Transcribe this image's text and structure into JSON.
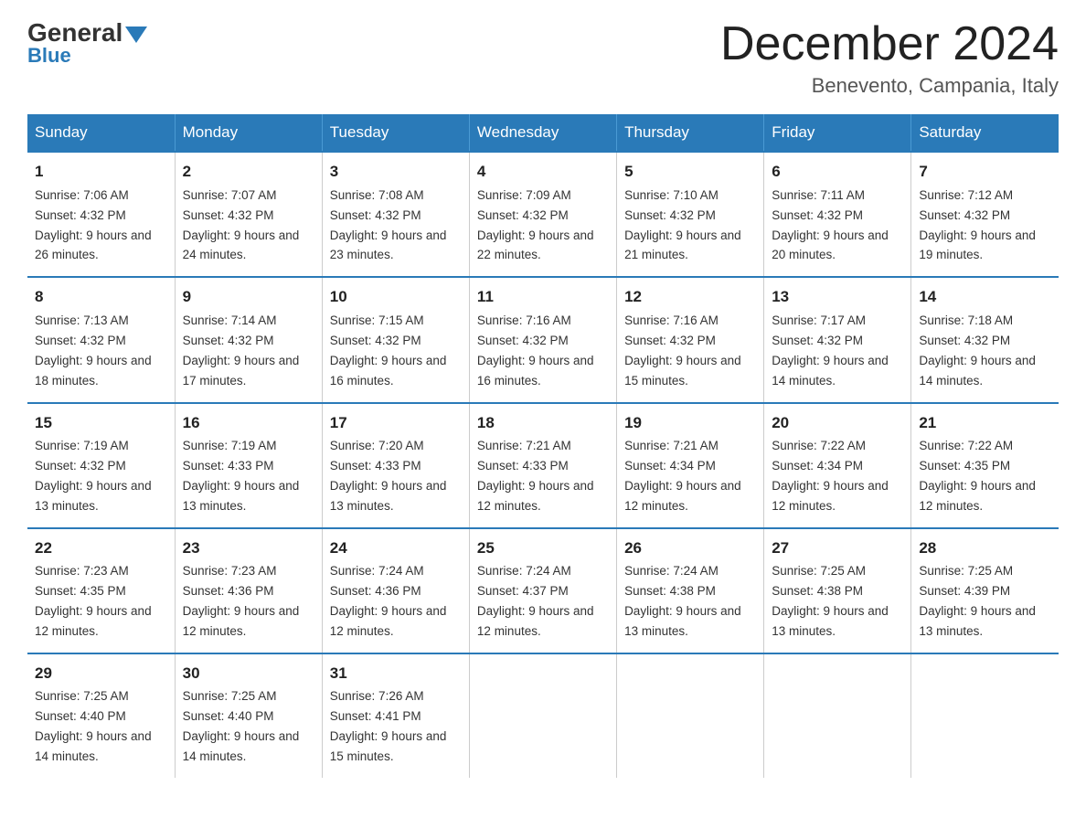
{
  "logo": {
    "general": "General",
    "blue": "Blue"
  },
  "header": {
    "title": "December 2024",
    "subtitle": "Benevento, Campania, Italy"
  },
  "days_of_week": [
    "Sunday",
    "Monday",
    "Tuesday",
    "Wednesday",
    "Thursday",
    "Friday",
    "Saturday"
  ],
  "weeks": [
    [
      {
        "num": "1",
        "sunrise": "7:06 AM",
        "sunset": "4:32 PM",
        "daylight": "9 hours and 26 minutes."
      },
      {
        "num": "2",
        "sunrise": "7:07 AM",
        "sunset": "4:32 PM",
        "daylight": "9 hours and 24 minutes."
      },
      {
        "num": "3",
        "sunrise": "7:08 AM",
        "sunset": "4:32 PM",
        "daylight": "9 hours and 23 minutes."
      },
      {
        "num": "4",
        "sunrise": "7:09 AM",
        "sunset": "4:32 PM",
        "daylight": "9 hours and 22 minutes."
      },
      {
        "num": "5",
        "sunrise": "7:10 AM",
        "sunset": "4:32 PM",
        "daylight": "9 hours and 21 minutes."
      },
      {
        "num": "6",
        "sunrise": "7:11 AM",
        "sunset": "4:32 PM",
        "daylight": "9 hours and 20 minutes."
      },
      {
        "num": "7",
        "sunrise": "7:12 AM",
        "sunset": "4:32 PM",
        "daylight": "9 hours and 19 minutes."
      }
    ],
    [
      {
        "num": "8",
        "sunrise": "7:13 AM",
        "sunset": "4:32 PM",
        "daylight": "9 hours and 18 minutes."
      },
      {
        "num": "9",
        "sunrise": "7:14 AM",
        "sunset": "4:32 PM",
        "daylight": "9 hours and 17 minutes."
      },
      {
        "num": "10",
        "sunrise": "7:15 AM",
        "sunset": "4:32 PM",
        "daylight": "9 hours and 16 minutes."
      },
      {
        "num": "11",
        "sunrise": "7:16 AM",
        "sunset": "4:32 PM",
        "daylight": "9 hours and 16 minutes."
      },
      {
        "num": "12",
        "sunrise": "7:16 AM",
        "sunset": "4:32 PM",
        "daylight": "9 hours and 15 minutes."
      },
      {
        "num": "13",
        "sunrise": "7:17 AM",
        "sunset": "4:32 PM",
        "daylight": "9 hours and 14 minutes."
      },
      {
        "num": "14",
        "sunrise": "7:18 AM",
        "sunset": "4:32 PM",
        "daylight": "9 hours and 14 minutes."
      }
    ],
    [
      {
        "num": "15",
        "sunrise": "7:19 AM",
        "sunset": "4:32 PM",
        "daylight": "9 hours and 13 minutes."
      },
      {
        "num": "16",
        "sunrise": "7:19 AM",
        "sunset": "4:33 PM",
        "daylight": "9 hours and 13 minutes."
      },
      {
        "num": "17",
        "sunrise": "7:20 AM",
        "sunset": "4:33 PM",
        "daylight": "9 hours and 13 minutes."
      },
      {
        "num": "18",
        "sunrise": "7:21 AM",
        "sunset": "4:33 PM",
        "daylight": "9 hours and 12 minutes."
      },
      {
        "num": "19",
        "sunrise": "7:21 AM",
        "sunset": "4:34 PM",
        "daylight": "9 hours and 12 minutes."
      },
      {
        "num": "20",
        "sunrise": "7:22 AM",
        "sunset": "4:34 PM",
        "daylight": "9 hours and 12 minutes."
      },
      {
        "num": "21",
        "sunrise": "7:22 AM",
        "sunset": "4:35 PM",
        "daylight": "9 hours and 12 minutes."
      }
    ],
    [
      {
        "num": "22",
        "sunrise": "7:23 AM",
        "sunset": "4:35 PM",
        "daylight": "9 hours and 12 minutes."
      },
      {
        "num": "23",
        "sunrise": "7:23 AM",
        "sunset": "4:36 PM",
        "daylight": "9 hours and 12 minutes."
      },
      {
        "num": "24",
        "sunrise": "7:24 AM",
        "sunset": "4:36 PM",
        "daylight": "9 hours and 12 minutes."
      },
      {
        "num": "25",
        "sunrise": "7:24 AM",
        "sunset": "4:37 PM",
        "daylight": "9 hours and 12 minutes."
      },
      {
        "num": "26",
        "sunrise": "7:24 AM",
        "sunset": "4:38 PM",
        "daylight": "9 hours and 13 minutes."
      },
      {
        "num": "27",
        "sunrise": "7:25 AM",
        "sunset": "4:38 PM",
        "daylight": "9 hours and 13 minutes."
      },
      {
        "num": "28",
        "sunrise": "7:25 AM",
        "sunset": "4:39 PM",
        "daylight": "9 hours and 13 minutes."
      }
    ],
    [
      {
        "num": "29",
        "sunrise": "7:25 AM",
        "sunset": "4:40 PM",
        "daylight": "9 hours and 14 minutes."
      },
      {
        "num": "30",
        "sunrise": "7:25 AM",
        "sunset": "4:40 PM",
        "daylight": "9 hours and 14 minutes."
      },
      {
        "num": "31",
        "sunrise": "7:26 AM",
        "sunset": "4:41 PM",
        "daylight": "9 hours and 15 minutes."
      },
      null,
      null,
      null,
      null
    ]
  ],
  "labels": {
    "sunrise": "Sunrise:",
    "sunset": "Sunset:",
    "daylight": "Daylight:"
  }
}
